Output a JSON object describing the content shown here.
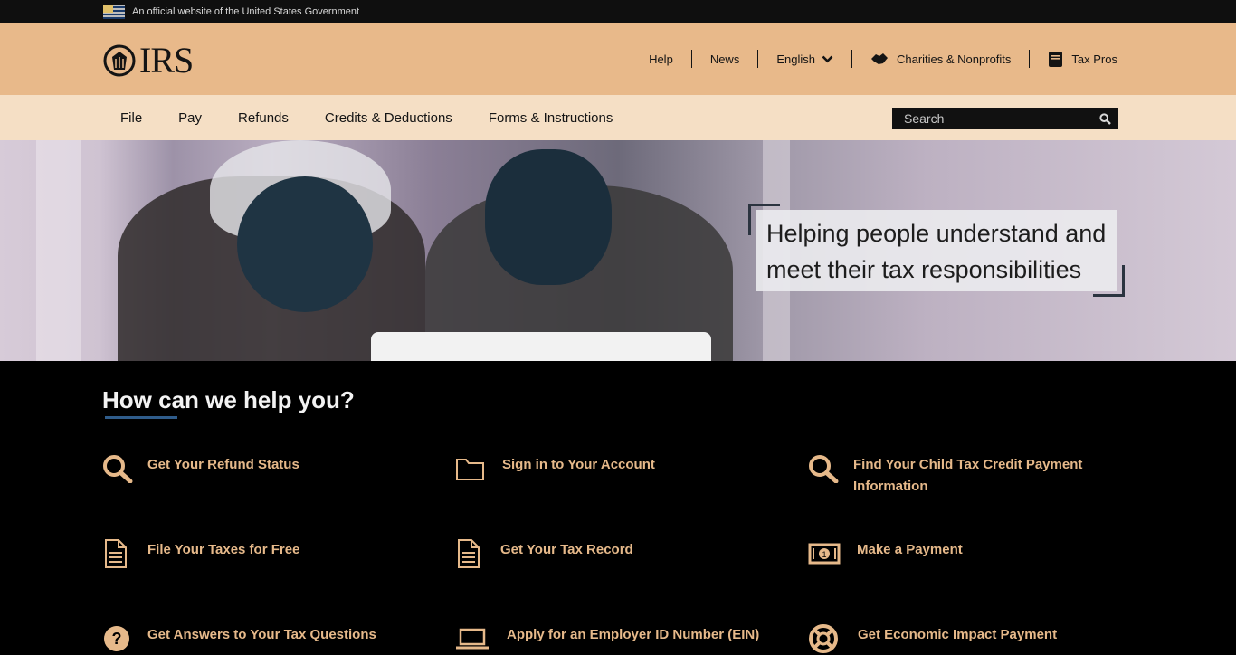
{
  "gov_banner": {
    "text": "An official website of the United States Government"
  },
  "logo": {
    "text": "IRS"
  },
  "header_nav": {
    "help": "Help",
    "news": "News",
    "language": "English",
    "charities": "Charities & Nonprofits",
    "tax_pros": "Tax Pros"
  },
  "main_nav": [
    "File",
    "Pay",
    "Refunds",
    "Credits & Deductions",
    "Forms & Instructions"
  ],
  "search": {
    "placeholder": "Search"
  },
  "hero": {
    "callout": "Helping people understand and meet their tax responsibilities"
  },
  "help": {
    "title": "How can we help you?",
    "tiles": [
      {
        "label": "Get Your Refund Status",
        "icon": "search-icon"
      },
      {
        "label": "Sign in to Your Account",
        "icon": "folder-icon"
      },
      {
        "label": "Find Your Child Tax Credit Payment Information",
        "icon": "search-icon"
      },
      {
        "label": "File Your Taxes for Free",
        "icon": "document-icon"
      },
      {
        "label": "Get Your Tax Record",
        "icon": "document-icon"
      },
      {
        "label": "Make a Payment",
        "icon": "money-icon"
      },
      {
        "label": "Get Answers to Your Tax Questions",
        "icon": "question-icon"
      },
      {
        "label": "Apply for an Employer ID Number (EIN)",
        "icon": "laptop-icon"
      },
      {
        "label": "Get Economic Impact Payment",
        "icon": "lifebuoy-icon"
      }
    ]
  },
  "colors": {
    "accent": "#e6b98a",
    "header_bg": "#e8b98a",
    "nav_bg": "#f5dfc5",
    "page_bg": "#000000"
  }
}
